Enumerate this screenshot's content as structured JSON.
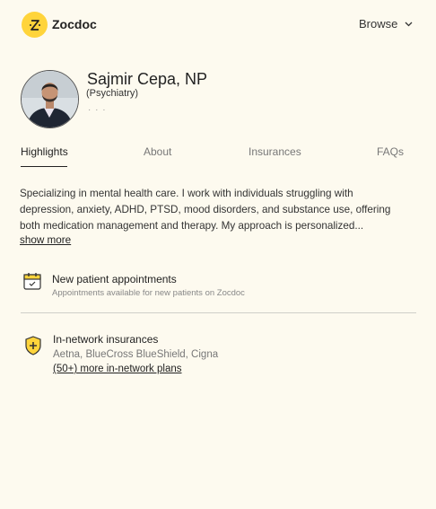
{
  "header": {
    "brand": "Zocdoc",
    "browse_label": "Browse"
  },
  "provider": {
    "name": "Sajmir Cepa, NP",
    "specialty": "(Psychiatry)",
    "more": "· · ·"
  },
  "tabs": [
    {
      "label": "Highlights"
    },
    {
      "label": "About"
    },
    {
      "label": "Insurances"
    },
    {
      "label": "FAQs"
    }
  ],
  "bio": {
    "text": "Specializing in mental health care. I work with individuals struggling with depression, anxiety, ADHD, PTSD, mood disorders, and substance use, offering both medication management and therapy. My approach is personalized...",
    "show_more": "show more"
  },
  "appointments": {
    "title": "New patient appointments",
    "subtitle": "Appointments available for new patients on Zocdoc"
  },
  "insurances": {
    "title": "In-network insurances",
    "list": "Aetna, BlueCross BlueShield, Cigna",
    "more_link": "(50+) more in-network plans"
  },
  "colors": {
    "background": "#fdfaef",
    "brand_yellow": "#ffd43b",
    "text": "#333333",
    "muted": "#888888"
  }
}
